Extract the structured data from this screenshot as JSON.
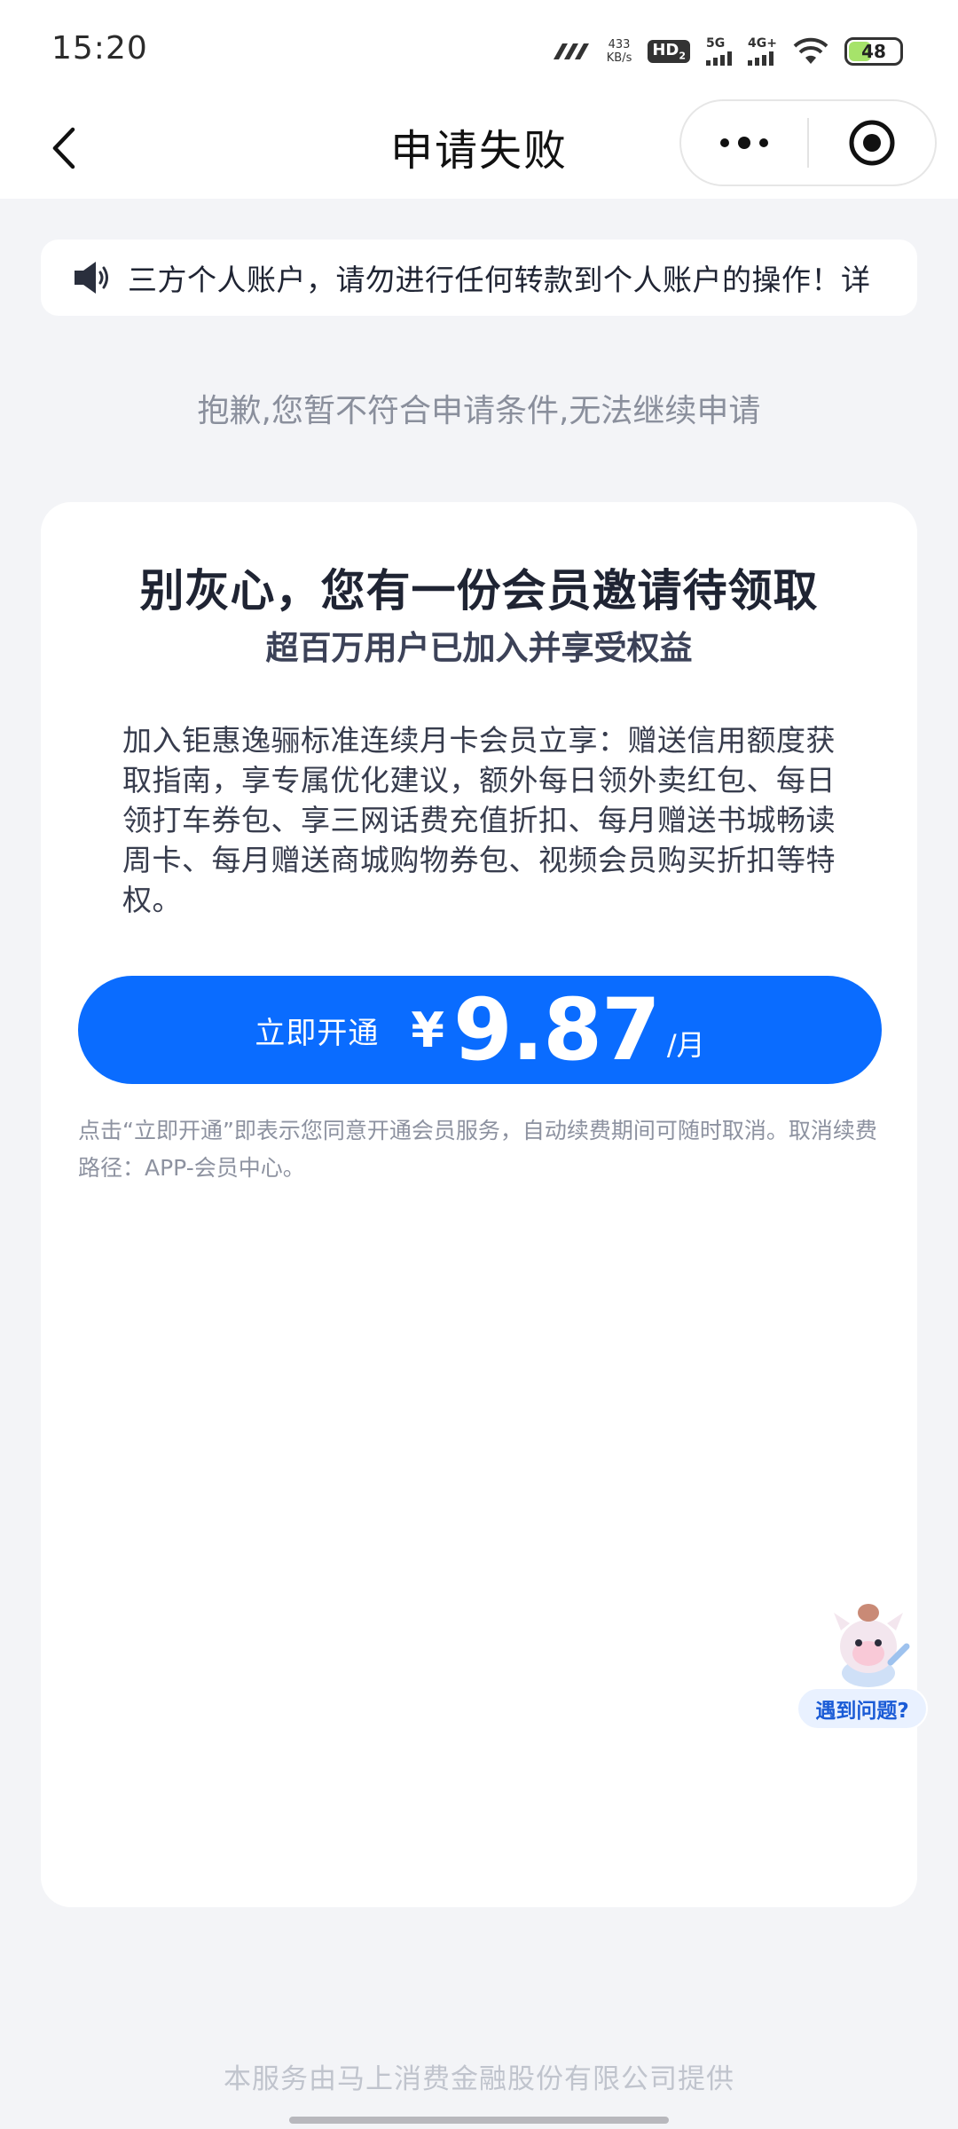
{
  "status_bar": {
    "time": "15:20",
    "net_speed_value": "433",
    "net_speed_unit": "KB/s",
    "hd_label": "HD",
    "hd_sub": "2",
    "net1_label": "5G",
    "net2_label": "4G+",
    "battery": "48",
    "battery_level_percent": 48,
    "battery_color": "#a6e36a"
  },
  "nav": {
    "title": "申请失败",
    "back_icon": "chevron-left-icon",
    "more_icon": "more-dots-icon",
    "close_icon": "target-close-icon"
  },
  "notice": {
    "icon": "speaker-icon",
    "text": "三方个人账户，请勿进行任何转款到个人账户的操作！详"
  },
  "fail_message": "抱歉,您暂不符合申请条件,无法继续申请",
  "card": {
    "title": "别灰心，您有一份会员邀请待领取",
    "subtitle": "超百万用户已加入并享受权益",
    "description": "加入钜惠逸骊标准连续月卡会员立享：赠送信用额度获取指南，享专属优化建议，额外每日领外卖红包、每日领打车券包、享三网话费充值折扣、每月赠送书城畅读周卡、每月赠送商城购物券包、视频会员购买折扣等特权。",
    "cta": {
      "label": "立即开通",
      "currency": "¥",
      "price": "9.87",
      "unit": "/月"
    },
    "agreement": "点击“立即开通”即表示您同意开通会员服务，自动续费期间可随时取消。取消续费路径：APP-会员中心。"
  },
  "helper": {
    "label": "遇到问题?"
  },
  "footer": "本服务由马上消费金融股份有限公司提供",
  "colors": {
    "accent": "#0a6cff",
    "page_bg": "#f3f4f7"
  }
}
